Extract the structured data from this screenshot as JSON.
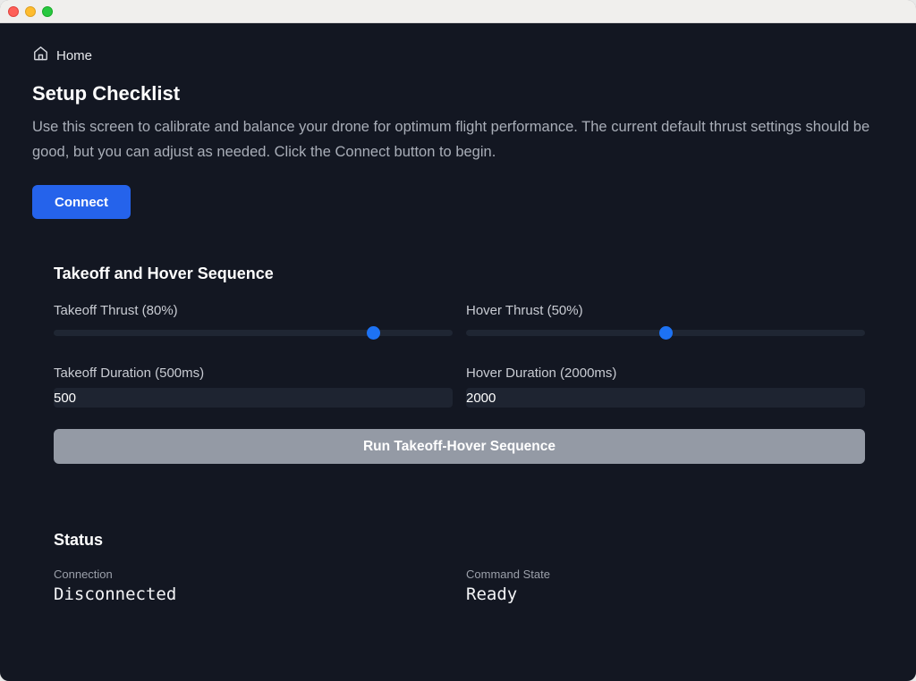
{
  "window": {
    "traffic_lights": [
      "close",
      "minimize",
      "zoom"
    ]
  },
  "breadcrumb": {
    "icon": "home-icon",
    "label": "Home"
  },
  "header": {
    "title": "Setup Checklist",
    "description": "Use this screen to calibrate and balance your drone for optimum flight performance. The current default thrust settings should be good, but you can adjust as needed. Click the Connect button to begin."
  },
  "connect": {
    "label": "Connect",
    "color": "#2563eb"
  },
  "sequence": {
    "title": "Takeoff and Hover Sequence",
    "takeoff_thrust": {
      "label": "Takeoff Thrust (80%)",
      "value_percent": 80
    },
    "hover_thrust": {
      "label": "Hover Thrust (50%)",
      "value_percent": 50
    },
    "takeoff_duration": {
      "label": "Takeoff Duration (500ms)",
      "value": "500"
    },
    "hover_duration": {
      "label": "Hover Duration (2000ms)",
      "value": "2000"
    },
    "run_button": {
      "label": "Run Takeoff-Hover Sequence",
      "color": "#949aa5"
    }
  },
  "status": {
    "title": "Status",
    "connection": {
      "label": "Connection",
      "value": "Disconnected"
    },
    "command_state": {
      "label": "Command State",
      "value": "Ready"
    }
  },
  "colors": {
    "background": "#131722",
    "slider_thumb": "#1d72f3"
  }
}
